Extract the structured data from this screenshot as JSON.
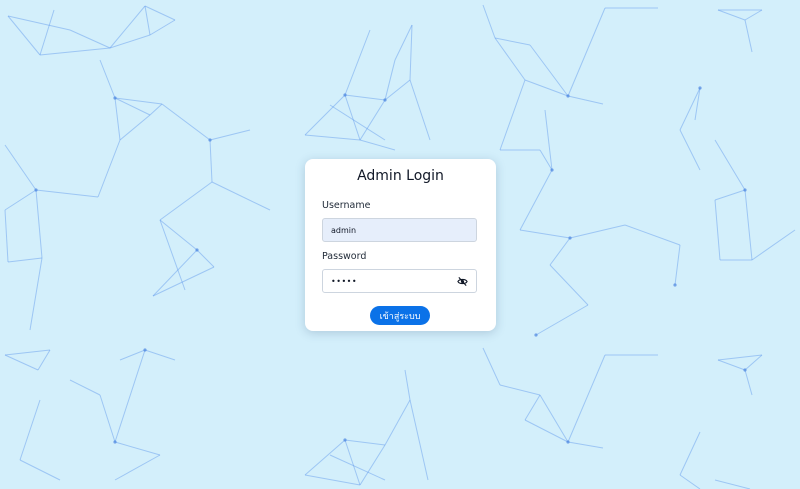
{
  "login": {
    "title": "Admin Login",
    "username_label": "Username",
    "username_value": "admin",
    "password_label": "Password",
    "password_masked": "•••••",
    "submit_label": "เข้าสู่ระบบ"
  },
  "icons": {
    "password_toggle": "eye-off-icon"
  },
  "colors": {
    "background": "#d3effb",
    "network": "#5b95ea",
    "button": "#0b72e8",
    "username_field": "#e6eefb"
  }
}
